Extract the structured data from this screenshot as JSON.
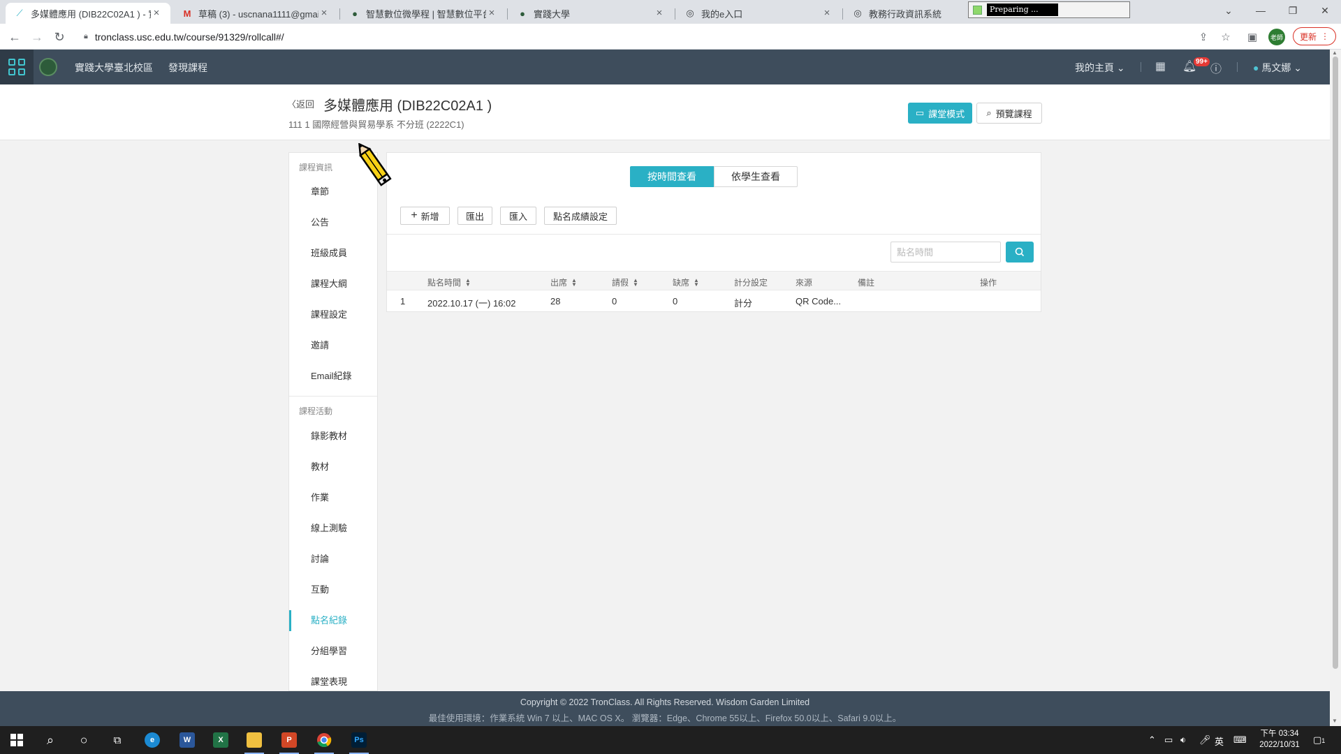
{
  "browser": {
    "tabs": [
      {
        "title": "多媒體應用 (DIB22C02A1 ) - 實",
        "active": true
      },
      {
        "title": "草稿 (3) - uscnana1111@gmail",
        "active": false
      },
      {
        "title": "智慧數位微學程 | 智慧數位平台",
        "active": false
      },
      {
        "title": "實踐大學",
        "active": false
      },
      {
        "title": "我的e入口",
        "active": false
      },
      {
        "title": "教務行政資訊系統",
        "active": false
      }
    ],
    "preparing_label": "Preparing ...",
    "url": "tronclass.usc.edu.tw/course/91329/rollcall#/",
    "profile_label": "老師",
    "update_label": "更新"
  },
  "header": {
    "school_link": "實踐大學臺北校區",
    "discover_link": "發現課程",
    "my_home": "我的主頁",
    "notification_badge": "99+",
    "user_name": "馬文娜"
  },
  "course": {
    "back_label": "返回",
    "title": "多媒體應用 (DIB22C02A1 )",
    "subtitle": "111 1 國際經營與貿易學系 不分班 (2222C1)",
    "class_mode_button": "課堂模式",
    "preview_button": "預覽課程"
  },
  "sidebar": {
    "section1": "課程資訊",
    "items1": [
      "章節",
      "公告",
      "班級成員",
      "課程大綱",
      "課程設定",
      "邀請",
      "Email紀錄"
    ],
    "section2": "課程活動",
    "items2": [
      "錄影教材",
      "教材",
      "作業",
      "線上測驗",
      "討論",
      "互動",
      "點名紀錄",
      "分組學習",
      "課堂表現"
    ],
    "active_item": "點名紀錄"
  },
  "rollcall": {
    "view_by_time": "按時間查看",
    "view_by_student": "依學生查看",
    "add_button": "新增",
    "export_button": "匯出",
    "import_button": "匯入",
    "score_setting_button": "點名成績設定",
    "search_placeholder": "點名時間",
    "columns": [
      "點名時間",
      "出席",
      "請假",
      "缺席",
      "計分設定",
      "來源",
      "備註",
      "操作"
    ],
    "rows": [
      {
        "index": "1",
        "time": "2022.10.17 (一) 16:02",
        "present": "28",
        "leave": "0",
        "absent": "0",
        "scoring": "計分",
        "source": "QR Code...",
        "note": "",
        "action": ""
      }
    ]
  },
  "footer": {
    "copyright": "Copyright © 2022 TronClass. All Rights Reserved. Wisdom Garden Limited",
    "environment": "最佳使用環境：作業系統 Win 7 以上、MAC OS X。 瀏覽器：Edge、Chrome 55以上、Firefox 50.0以上、Safari 9.0以上。"
  },
  "taskbar": {
    "ime": "英",
    "time": "下午 03:34",
    "date": "2022/10/31",
    "notification_count": "1"
  },
  "colors": {
    "accent": "#2ab0c5",
    "header_bg": "#3e4d5c",
    "update_red": "#d93025"
  }
}
